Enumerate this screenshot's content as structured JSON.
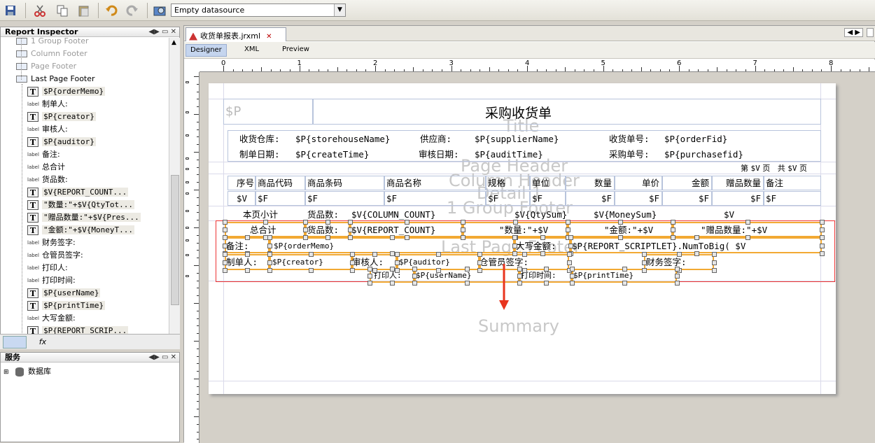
{
  "toolbar": {
    "datasource": "Empty datasource"
  },
  "inspector": {
    "title": "Report Inspector",
    "items": [
      {
        "label": "1 Group Footer",
        "kind": "band",
        "grey": true
      },
      {
        "label": "Column Footer",
        "kind": "band",
        "grey": true
      },
      {
        "label": "Page Footer",
        "kind": "band",
        "grey": true
      },
      {
        "label": "Last Page Footer",
        "kind": "band",
        "grey": false
      },
      {
        "label": "$P{orderMemo}",
        "kind": "text"
      },
      {
        "label": "制单人:",
        "kind": "label"
      },
      {
        "label": "$P{creator}",
        "kind": "text"
      },
      {
        "label": "审核人:",
        "kind": "label"
      },
      {
        "label": "$P{auditor}",
        "kind": "text"
      },
      {
        "label": "备注:",
        "kind": "label"
      },
      {
        "label": "总合计",
        "kind": "label"
      },
      {
        "label": "货品数:",
        "kind": "label"
      },
      {
        "label": "$V{REPORT_COUNT...",
        "kind": "text"
      },
      {
        "label": "\"数量:\"+$V{QtyTot...",
        "kind": "text"
      },
      {
        "label": "\"赠品数量:\"+$V{Pres...",
        "kind": "text"
      },
      {
        "label": "\"金额:\"+$V{MoneyT...",
        "kind": "text"
      },
      {
        "label": "财务签字:",
        "kind": "label"
      },
      {
        "label": "仓管员签字:",
        "kind": "label"
      },
      {
        "label": "打印人:",
        "kind": "label"
      },
      {
        "label": "打印时间:",
        "kind": "label"
      },
      {
        "label": "$P{userName}",
        "kind": "text"
      },
      {
        "label": "$P{printTime}",
        "kind": "text"
      },
      {
        "label": "大写金额:",
        "kind": "label"
      },
      {
        "label": "$P{REPORT_SCRIP...",
        "kind": "text"
      }
    ],
    "tab_fx": "fx"
  },
  "services": {
    "title": "服务",
    "items": [
      "数据库"
    ]
  },
  "editor": {
    "doc_tab": "收货单报表.jrxml",
    "subtabs": [
      "Designer",
      "XML",
      "Preview"
    ],
    "ruler": [
      "0",
      "1",
      "2",
      "3",
      "4",
      "5",
      "6",
      "7",
      "8"
    ]
  },
  "report": {
    "watermarks": [
      "Title",
      "Page Header",
      "Column Header",
      "Detail 1",
      "1 Group Footer",
      "Last Page Footer",
      "Summary"
    ],
    "title": "采购收货单",
    "img_placeholder": "$P",
    "header": {
      "store_label": "收货仓库:",
      "store_val": "$P{storehouseName}",
      "supplier_label": "供应商:",
      "supplier_val": "$P{supplierName}",
      "recv_no_label": "收货单号:",
      "recv_no_val": "$P{orderFid}",
      "date_label": "制单日期:",
      "date_val": "$P{createTime}",
      "audit_date_label": "审核日期:",
      "audit_date_val": "$P{auditTime}",
      "po_label": "采购单号:",
      "po_val": "$P{purchasefid}"
    },
    "page": {
      "p1": "第",
      "v1": "$V",
      "p2": "页",
      "p3": "共",
      "v2": "$V",
      "p4": "页"
    },
    "columns": [
      "序号",
      "商品代码",
      "商品条码",
      "商品名称",
      "规格",
      "单位",
      "数量",
      "单价",
      "金额",
      "赠品数量",
      "备注"
    ],
    "detail": [
      "$V",
      "$F",
      "$F",
      "$F",
      "$F",
      "$F",
      "$F",
      "$F",
      "$F",
      "$F",
      "$F"
    ],
    "group_footer": {
      "label": "本页小计",
      "count_label": "货品数:",
      "count_val": "$V{COLUMN_COUNT}",
      "qty": "$V{QtySum}",
      "money": "$V{MoneySum}",
      "v": "$V"
    },
    "last_footer": {
      "total": "总合计",
      "count_label": "货品数:",
      "count_val": "$V{REPORT_COUNT}",
      "qty": "\"数量:\"+$V",
      "money": "\"金额:\"+$V",
      "gift": "\"赠品数量:\"+$V",
      "memo_label": "备注:",
      "memo_val": "$P{orderMemo}",
      "big_label": "大写金额:",
      "big_val": "$P{REPORT_SCRIPTLET}.NumToBig( $V",
      "creator_label": "制单人:",
      "creator_val": "$P{creator}",
      "auditor_label": "审核人:",
      "auditor_val": "$P{auditor}",
      "keeper": "仓管员签字:",
      "finance": "财务签字:",
      "printer_label": "打印人:",
      "printer_val": "$P{userName}",
      "ptime_label": "打印时间:",
      "ptime_val": "$P{printTime}"
    }
  }
}
